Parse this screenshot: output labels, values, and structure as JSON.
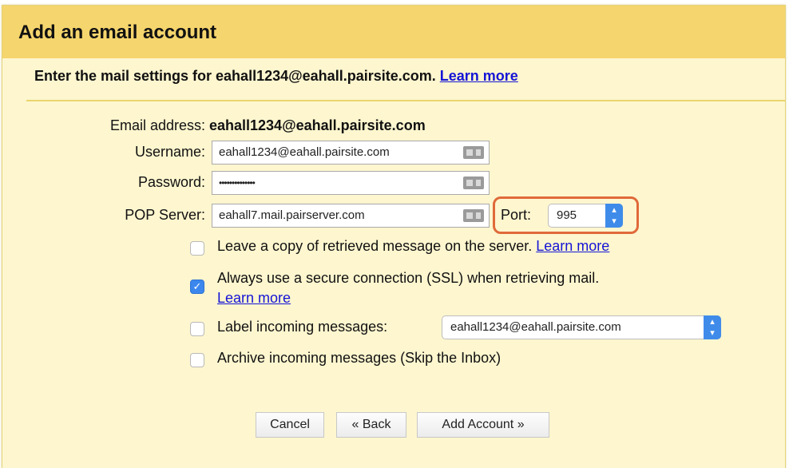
{
  "dialog": {
    "title": "Add an email account",
    "subtitle": "Enter the mail settings for eahall1234@eahall.pairsite.com.",
    "subtitle_link": "Learn more"
  },
  "form": {
    "email_label": "Email address:",
    "email_value": "eahall1234@eahall.pairsite.com",
    "username_label": "Username:",
    "username_value": "eahall1234@eahall.pairsite.com",
    "password_label": "Password:",
    "password_value": "••••••••••••••",
    "pop_label": "POP Server:",
    "pop_value": "eahall7.mail.pairserver.com",
    "port_label": "Port:",
    "port_value": "995"
  },
  "options": {
    "leave_copy": {
      "label": "Leave a copy of retrieved message on the server.",
      "link": "Learn more",
      "checked": false
    },
    "ssl": {
      "label": "Always use a secure connection (SSL) when retrieving mail.",
      "link": "Learn more",
      "checked": true
    },
    "label_incoming": {
      "label": "Label incoming messages:",
      "select_value": "eahall1234@eahall.pairsite.com",
      "checked": false
    },
    "archive": {
      "label": "Archive incoming messages (Skip the Inbox)",
      "checked": false
    }
  },
  "buttons": {
    "cancel": "Cancel",
    "back": "« Back",
    "add": "Add Account »"
  },
  "colors": {
    "title_bar": "#f5d56d",
    "panel": "#fdf6cf",
    "link": "#1515d6",
    "highlight": "#e06a3a",
    "checkbox_checked": "#3b87ee"
  }
}
